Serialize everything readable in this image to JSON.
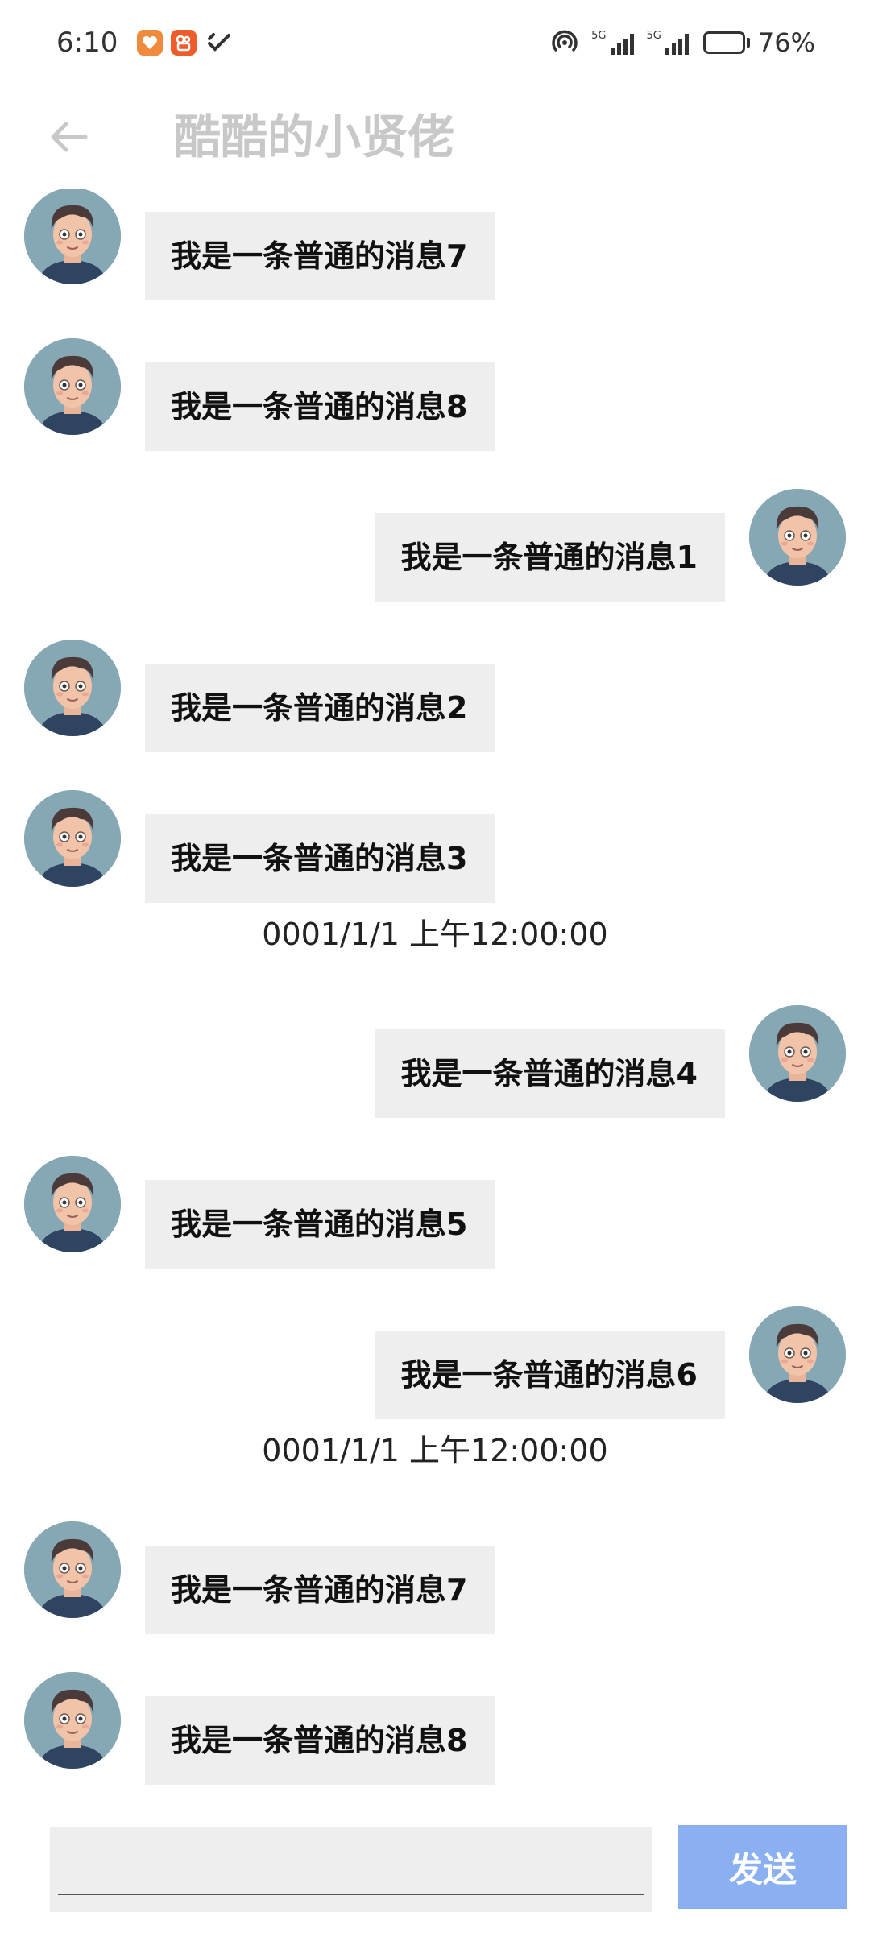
{
  "status_bar": {
    "time": "6:10",
    "signal1_label": "5G",
    "signal2_label": "5G",
    "battery_percent": "76%",
    "battery_level": 0.76,
    "icons": [
      "heart-app-icon",
      "kuaishou-app-icon",
      "check-app-icon",
      "hotspot-icon",
      "signal-icon",
      "signal-icon",
      "battery-icon"
    ]
  },
  "header": {
    "back_icon": "arrow-left-icon",
    "title": "酷酷的小贤佬"
  },
  "colors": {
    "bubble_bg": "#eeeeee",
    "send_button_bg": "#8ab0f2",
    "title_color": "#c8c8c8",
    "avatar_bg": "#86a7b4"
  },
  "messages": [
    {
      "type": "message",
      "side": "left",
      "text": "我是一条普通的消息7"
    },
    {
      "type": "message",
      "side": "left",
      "text": "我是一条普通的消息8"
    },
    {
      "type": "message",
      "side": "right",
      "text": "我是一条普通的消息1"
    },
    {
      "type": "message",
      "side": "left",
      "text": "我是一条普通的消息2"
    },
    {
      "type": "message",
      "side": "left",
      "text": "我是一条普通的消息3"
    },
    {
      "type": "timestamp",
      "text": "0001/1/1 上午12:00:00"
    },
    {
      "type": "message",
      "side": "right",
      "text": "我是一条普通的消息4"
    },
    {
      "type": "message",
      "side": "left",
      "text": "我是一条普通的消息5"
    },
    {
      "type": "message",
      "side": "right",
      "text": "我是一条普通的消息6"
    },
    {
      "type": "timestamp",
      "text": "0001/1/1 上午12:00:00"
    },
    {
      "type": "message",
      "side": "left",
      "text": "我是一条普通的消息7"
    },
    {
      "type": "message",
      "side": "left",
      "text": "我是一条普通的消息8"
    }
  ],
  "input": {
    "value": "",
    "placeholder": "",
    "send_label": "发送"
  }
}
